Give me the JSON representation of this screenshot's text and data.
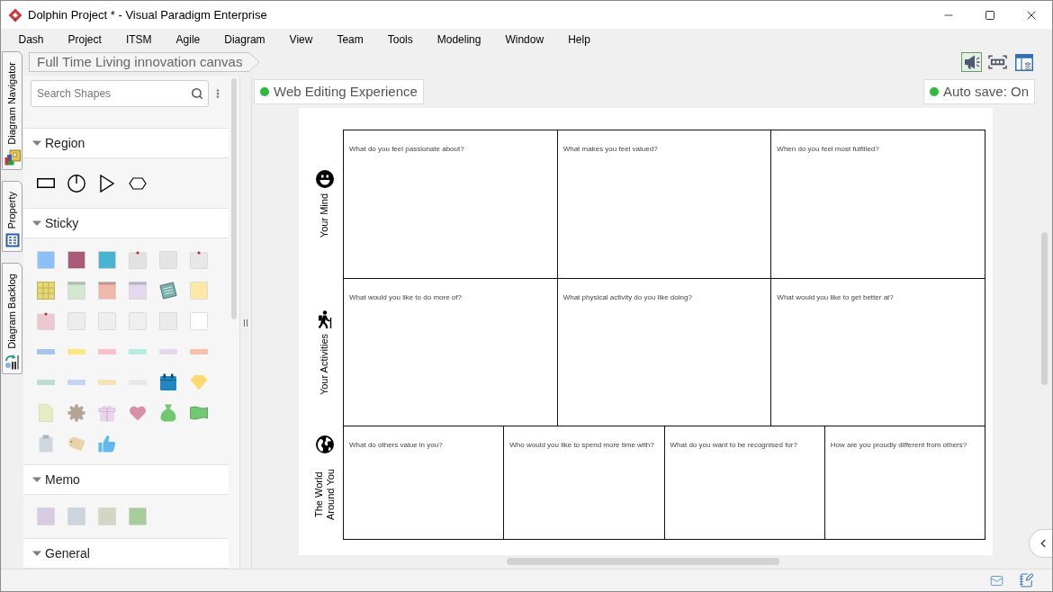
{
  "window": {
    "title": "Dolphin Project * - Visual Paradigm Enterprise"
  },
  "menu": [
    "Dash",
    "Project",
    "ITSM",
    "Agile",
    "Diagram",
    "View",
    "Team",
    "Tools",
    "Modeling",
    "Window",
    "Help"
  ],
  "side_tabs": [
    {
      "label": "Diagram Navigator"
    },
    {
      "label": "Property"
    },
    {
      "label": "Diagram Backlog"
    }
  ],
  "breadcrumb": "Full Time Living innovation canvas",
  "toolbar": [
    {
      "selected": true
    },
    {
      "selected": false
    },
    {
      "selected": false
    }
  ],
  "palette": {
    "search": {
      "placeholder": "Search Shapes"
    },
    "sections": [
      {
        "title": "Region",
        "expanded": true,
        "shapes": [
          {
            "kind": "rectangle"
          },
          {
            "kind": "timer"
          },
          {
            "kind": "triangle"
          },
          {
            "kind": "hexagon"
          }
        ]
      },
      {
        "title": "Sticky",
        "expanded": true,
        "shapes": [
          {
            "kind": "note",
            "color": "#8ec0f8"
          },
          {
            "kind": "note",
            "color": "#a85a78"
          },
          {
            "kind": "note",
            "color": "#48b4d0"
          },
          {
            "kind": "pinned",
            "color": "#e2e2e2"
          },
          {
            "kind": "note",
            "color": "#e4e4e4"
          },
          {
            "kind": "pinned",
            "color": "#e8e8e8"
          },
          {
            "kind": "lined",
            "color": "#e4d878"
          },
          {
            "kind": "banded",
            "color": "#d4e8d0"
          },
          {
            "kind": "banded",
            "color": "#f0b8a8"
          },
          {
            "kind": "banded",
            "color": "#e4d8ee"
          },
          {
            "kind": "notepad",
            "color": "#78b0ac"
          },
          {
            "kind": "note",
            "color": "#fde8a8"
          },
          {
            "kind": "pinned",
            "color": "#ecc8d0"
          },
          {
            "kind": "note",
            "color": "#ececec"
          },
          {
            "kind": "note",
            "color": "#eeeeee"
          },
          {
            "kind": "note",
            "color": "#efefef"
          },
          {
            "kind": "note",
            "color": "#ebebeb"
          },
          {
            "kind": "note",
            "color": "#ffffff"
          },
          {
            "kind": "tape",
            "color": "#a8c4ec"
          },
          {
            "kind": "tape",
            "color": "#fde880"
          },
          {
            "kind": "tape",
            "color": "#f8c0c8"
          },
          {
            "kind": "tape",
            "color": "#b4ece0"
          },
          {
            "kind": "tape",
            "color": "#e4d8ee"
          },
          {
            "kind": "tape",
            "color": "#f8c0a8"
          },
          {
            "kind": "tape",
            "color": "#bcdcd4"
          },
          {
            "kind": "tape",
            "color": "#c4d4f4"
          },
          {
            "kind": "tape",
            "color": "#f0e4b8"
          },
          {
            "kind": "tape",
            "color": "#e8e8e8"
          },
          {
            "kind": "calendar",
            "color": "#2088c0"
          },
          {
            "kind": "diamond",
            "color": "#ffd870"
          },
          {
            "kind": "document",
            "color": "#e4ecc4"
          },
          {
            "kind": "gear",
            "color": "#b4a494"
          },
          {
            "kind": "gift",
            "color": "#ecd4ea"
          },
          {
            "kind": "heart",
            "color": "#d890a8"
          },
          {
            "kind": "bag",
            "color": "#70c870"
          },
          {
            "kind": "banner",
            "color": "#70c870"
          },
          {
            "kind": "clipboard",
            "color": "#cfd6de"
          },
          {
            "kind": "tag",
            "color": "#e8d4a8"
          },
          {
            "kind": "thumb",
            "color": "#60b8f0"
          }
        ]
      },
      {
        "title": "Memo",
        "expanded": true,
        "shapes": [
          {
            "kind": "note",
            "color": "#d8cce4"
          },
          {
            "kind": "note",
            "color": "#ccd4de"
          },
          {
            "kind": "note",
            "color": "#d2d6c2"
          },
          {
            "kind": "note",
            "color": "#a8cc9c"
          }
        ]
      },
      {
        "title": "General",
        "expanded": true
      }
    ]
  },
  "canvas": {
    "web_editing": "Web Editing Experience",
    "auto_save": "Auto save: On",
    "rows": [
      {
        "label": "Your Mind",
        "cells": [
          "What do you feel passionate about?",
          "What makes you feel valued?",
          "When do you feel most fulfilled?"
        ]
      },
      {
        "label": "Your Activities",
        "cells": [
          "What would you like to do more of?",
          "What physical activity do you like doing?",
          "What would you like to get better at?"
        ]
      },
      {
        "label": "The World Around You",
        "cells": [
          "What do others value in you?",
          "Who would you like to spend more time with?",
          "What do you want to be recognised for?",
          "How are you proudly different from others?"
        ]
      }
    ]
  }
}
